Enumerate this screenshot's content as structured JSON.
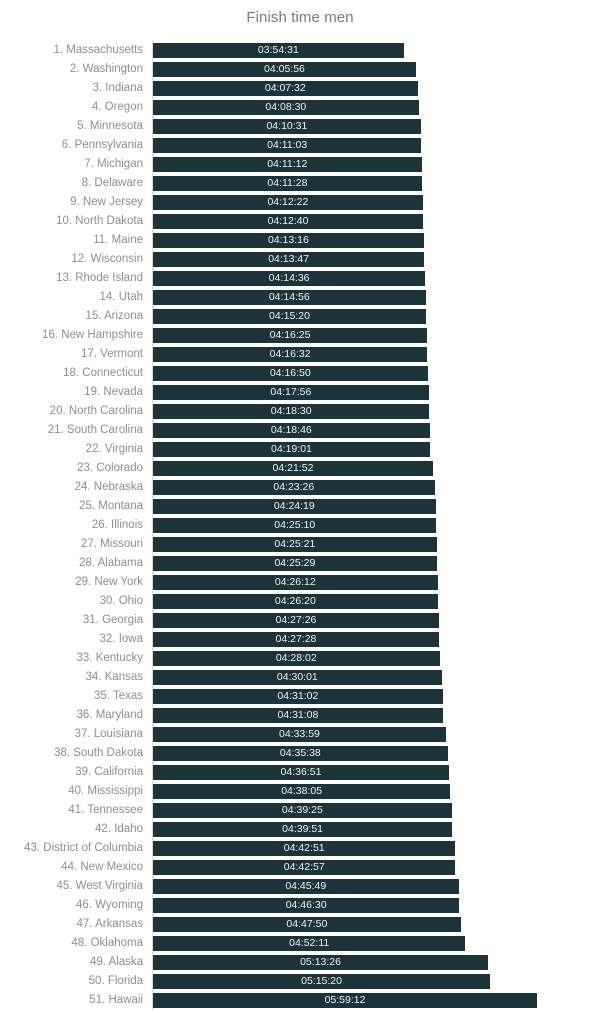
{
  "chart_data": {
    "type": "bar",
    "orientation": "horizontal",
    "title": "Finish time men",
    "xlabel": "",
    "ylabel": "",
    "grid": false,
    "legend": null,
    "value_format": "hh:mm:ss",
    "bar_color": "#1c3339",
    "label_color": "#8e8e93",
    "value_text_color": "#eef3f4",
    "background_color": "#ffffff",
    "axis_line_color": "#d9d9dd",
    "xlim_seconds": [
      0,
      21552
    ],
    "categories": [
      "1. Massachusetts",
      "2. Washington",
      "3. Indiana",
      "4. Oregon",
      "5. Minnesota",
      "6. Pennsylvania",
      "7. Michigan",
      "8. Delaware",
      "9. New Jersey",
      "10. North Dakota",
      "11. Maine",
      "12. Wisconsin",
      "13. Rhode Island",
      "14. Utah",
      "15. Arizona",
      "16. New Hampshire",
      "17. Vermont",
      "18. Connecticut",
      "19. Nevada",
      "20. North Carolina",
      "21. South Carolina",
      "22. Virginia",
      "23. Colorado",
      "24. Nebraska",
      "25. Montana",
      "26. Illinois",
      "27. Missouri",
      "28. Alabama",
      "29. New York",
      "30. Ohio",
      "31. Georgia",
      "32. Iowa",
      "33. Kentucky",
      "34. Kansas",
      "35. Texas",
      "36. Maryland",
      "37. Louisiana",
      "38. South Dakota",
      "39. California",
      "40. Mississippi",
      "41. Tennessee",
      "42. Idaho",
      "43. District of Columbia",
      "44. New Mexico",
      "45. West Virginia",
      "46. Wyoming",
      "47. Arkansas",
      "48. Oklahoma",
      "49. Alaska",
      "50. Florida",
      "51. Hawaii"
    ],
    "value_labels": [
      "03:54:31",
      "04:05:56",
      "04:07:32",
      "04:08:30",
      "04:10:31",
      "04:11:03",
      "04:11:12",
      "04:11:28",
      "04:12:22",
      "04:12:40",
      "04:13:16",
      "04:13:47",
      "04:14:36",
      "04:14:56",
      "04:15:20",
      "04:16:25",
      "04:16:32",
      "04:16:50",
      "04:17:56",
      "04:18:30",
      "04:18:46",
      "04:19:01",
      "04:21:52",
      "04:23:26",
      "04:24:19",
      "04:25:10",
      "04:25:21",
      "04:25:29",
      "04:26:12",
      "04:26:20",
      "04:27:26",
      "04:27:28",
      "04:28:02",
      "04:30:01",
      "04:31:02",
      "04:31:08",
      "04:33:59",
      "04:35:38",
      "04:36:51",
      "04:38:05",
      "04:39:25",
      "04:39:51",
      "04:42:51",
      "04:42:57",
      "04:45:49",
      "04:46:30",
      "04:47:50",
      "04:52:11",
      "05:13:26",
      "05:15:20",
      "05:59:12"
    ],
    "values": [
      14071,
      14756,
      14852,
      14910,
      15031,
      15063,
      15072,
      15088,
      15142,
      15160,
      15196,
      15227,
      15276,
      15296,
      15320,
      15385,
      15392,
      15410,
      15476,
      15510,
      15526,
      15541,
      15712,
      15806,
      15859,
      15910,
      15921,
      15929,
      15972,
      15980,
      16046,
      16048,
      16082,
      16201,
      16262,
      16268,
      16439,
      16538,
      16611,
      16685,
      16765,
      16791,
      16971,
      16977,
      17149,
      17190,
      17270,
      17531,
      18806,
      18920,
      21552
    ]
  }
}
